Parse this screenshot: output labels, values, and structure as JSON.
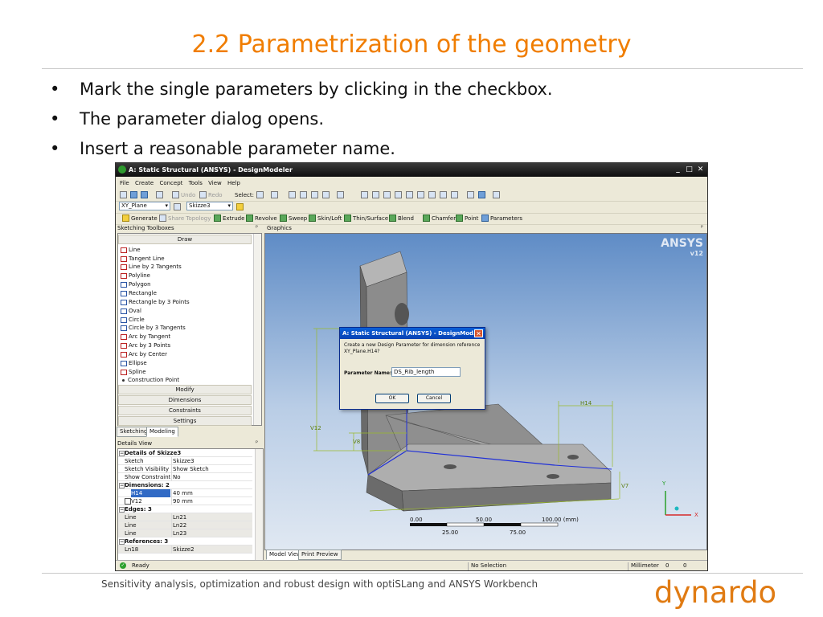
{
  "slide": {
    "title": "2.2 Parametrization of the geometry",
    "bullets": [
      "Mark the single parameters by clicking in the checkbox.",
      "The parameter dialog opens.",
      "Insert a reasonable parameter name."
    ],
    "bullet_symbol": "•",
    "footer": "Sensitivity analysis, optimization and robust design with optiSLang and ANSYS Workbench",
    "logo_text": "dynardo",
    "colors": {
      "title": "#f07d00",
      "logo": "#e07b13"
    }
  },
  "app": {
    "title": "A: Static Structural (ANSYS) - DesignModeler",
    "window_controls": {
      "minimize": "_",
      "maximize": "□",
      "close": "✕"
    },
    "menu": [
      "File",
      "Create",
      "Concept",
      "Tools",
      "View",
      "Help"
    ],
    "toolbar1": {
      "undo": "Undo",
      "redo": "Redo",
      "select": "Select:"
    },
    "toolbar2": {
      "plane": "XY_Plane",
      "sketch": "Skizze3"
    },
    "toolbar3": [
      "Generate",
      "Share Topology",
      "Extrude",
      "Revolve",
      "Sweep",
      "Skin/Loft",
      "Thin/Surface",
      "Blend",
      "Chamfer",
      "Point",
      "Parameters"
    ],
    "left_panel": {
      "header": "Sketching Toolboxes",
      "pin": "ᵖ",
      "draw_group": "Draw",
      "draw_items": [
        "Line",
        "Tangent Line",
        "Line by 2 Tangents",
        "Polyline",
        "Polygon",
        "Rectangle",
        "Rectangle by 3 Points",
        "Oval",
        "Circle",
        "Circle by 3 Tangents",
        "Arc by Tangent",
        "Arc by 3 Points",
        "Arc by Center",
        "Ellipse",
        "Spline",
        "Construction Point"
      ],
      "groups": [
        "Modify",
        "Dimensions",
        "Constraints",
        "Settings"
      ],
      "tabs": [
        "Sketching",
        "Modeling"
      ]
    },
    "details": {
      "header": "Details View",
      "title": "Details of Skizze3",
      "rows": [
        {
          "k": "Sketch",
          "v": "Skizze3"
        },
        {
          "k": "Sketch Visibility",
          "v": "Show Sketch"
        },
        {
          "k": "Show Constraints?",
          "v": "No"
        }
      ],
      "dimensions_hdr": "Dimensions: 2",
      "dimensions": [
        {
          "k": "H14",
          "v": "40 mm"
        },
        {
          "k": "V12",
          "v": "90 mm"
        }
      ],
      "edges_hdr": "Edges: 3",
      "edges": [
        {
          "k": "Line",
          "v": "Ln21"
        },
        {
          "k": "Line",
          "v": "Ln22"
        },
        {
          "k": "Line",
          "v": "Ln23"
        }
      ],
      "refs_hdr": "References: 3",
      "refs": [
        {
          "k": "Ln18",
          "v": "Skizze2"
        }
      ]
    },
    "graphics": {
      "header": "Graphics",
      "brand": "ANSYS",
      "version": "v12",
      "dims": {
        "v12": "V12",
        "v8": "V8",
        "h14": "H14",
        "v7": "V7"
      },
      "axes": {
        "x": "X",
        "y": "Y"
      },
      "scale": {
        "top": [
          "0.00",
          "50.00",
          "100.00 (mm)"
        ],
        "bottom": [
          "25.00",
          "75.00"
        ]
      },
      "tabs": [
        "Model View",
        "Print Preview"
      ]
    },
    "dialog": {
      "title": "A: Static Structural (ANSYS) - DesignMod...",
      "close": "✕",
      "message_line1": "Create a new Design Parameter for dimension reference",
      "message_line2": "XY_Plane.H14?",
      "label": "Parameter Name:",
      "value": "DS_Rib_length",
      "ok": "OK",
      "cancel": "Cancel"
    },
    "status": {
      "ready": "Ready",
      "selection": "No Selection",
      "unit": "Millimeter",
      "x": "0",
      "y": "0"
    }
  }
}
